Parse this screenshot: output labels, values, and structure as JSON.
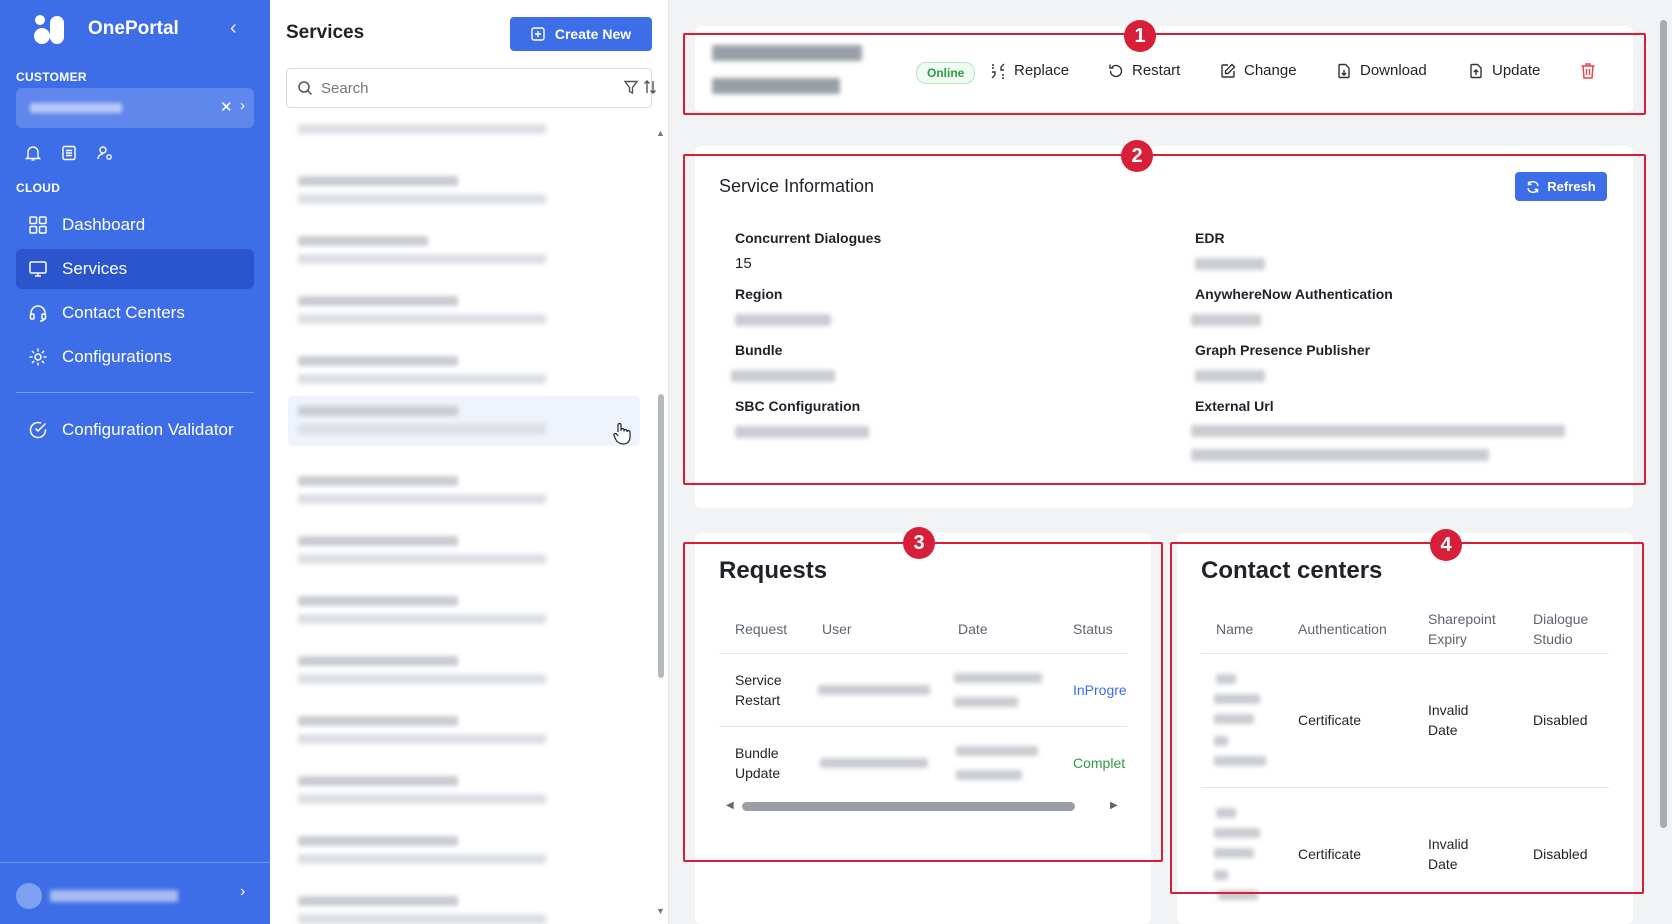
{
  "sidebar": {
    "brand": "OnePortal",
    "customer_label": "CUSTOMER",
    "cloud_label": "CLOUD",
    "nav": [
      {
        "label": "Dashboard",
        "icon": "dashboard-icon"
      },
      {
        "label": "Services",
        "icon": "monitor-icon",
        "active": true
      },
      {
        "label": "Contact Centers",
        "icon": "headset-icon"
      },
      {
        "label": "Configurations",
        "icon": "gear-icon"
      },
      {
        "label": "Configuration Validator",
        "icon": "check-circle-icon"
      }
    ]
  },
  "services_panel": {
    "title": "Services",
    "create_label": "Create New",
    "search_placeholder": "Search"
  },
  "service_header": {
    "status": "Online",
    "actions": {
      "replace": "Replace",
      "restart": "Restart",
      "change": "Change",
      "download": "Download",
      "update": "Update"
    }
  },
  "service_info": {
    "title": "Service Information",
    "refresh_label": "Refresh",
    "fields": {
      "concurrent_dialogues_label": "Concurrent Dialogues",
      "concurrent_dialogues_value": "15",
      "region_label": "Region",
      "bundle_label": "Bundle",
      "sbc_label": "SBC Configuration",
      "edr_label": "EDR",
      "anywherenow_label": "AnywhereNow Authentication",
      "graph_label": "Graph Presence Publisher",
      "external_url_label": "External Url"
    }
  },
  "requests": {
    "title": "Requests",
    "columns": [
      "Request",
      "User",
      "Date",
      "Status"
    ],
    "rows": [
      {
        "request_line1": "Service",
        "request_line2": "Restart",
        "status": "InProgre"
      },
      {
        "request_line1": "Bundle",
        "request_line2": "Update",
        "status": "Complet"
      }
    ]
  },
  "contact_centers": {
    "title": "Contact centers",
    "columns": {
      "name": "Name",
      "auth": "Authentication",
      "sharepoint_line1": "Sharepoint",
      "sharepoint_line2": "Expiry",
      "dialogue_line1": "Dialogue",
      "dialogue_line2": "Studio"
    },
    "rows": [
      {
        "auth": "Certificate",
        "expiry_line1": "Invalid",
        "expiry_line2": "Date",
        "studio": "Disabled"
      },
      {
        "auth": "Certificate",
        "expiry_line1": "Invalid",
        "expiry_line2": "Date",
        "studio": "Disabled"
      }
    ]
  },
  "annotations": [
    "1",
    "2",
    "3",
    "4"
  ],
  "colors": {
    "primary": "#3e6de8",
    "annotation": "#d81f3a",
    "online": "#2f9a44"
  }
}
